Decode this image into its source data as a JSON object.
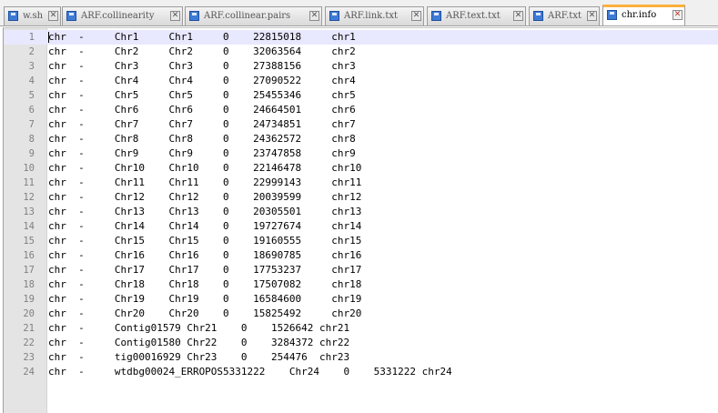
{
  "tabs": [
    {
      "label": "w.sh",
      "active": false
    },
    {
      "label": "ARF.collinearity",
      "active": false
    },
    {
      "label": "ARF.collinear.pairs",
      "active": false
    },
    {
      "label": "ARF.link.txt",
      "active": false
    },
    {
      "label": "ARF.text.txt",
      "active": false
    },
    {
      "label": "ARF.txt",
      "active": false
    },
    {
      "label": "chr.info",
      "active": true
    }
  ],
  "icons": {
    "tab_file": "save-disk-icon",
    "tab_close": "close-icon"
  },
  "colors": {
    "active_tab_accent": "#fbb13d",
    "current_line": "#e8e8ff",
    "gutter": "#e4e4e4",
    "line_number": "#808080"
  },
  "editor": {
    "lines": [
      {
        "n": "1",
        "text": "chr  -     Chr1     Chr1     0    22815018     chr1"
      },
      {
        "n": "2",
        "text": "chr  -     Chr2     Chr2     0    32063564     chr2"
      },
      {
        "n": "3",
        "text": "chr  -     Chr3     Chr3     0    27388156     chr3"
      },
      {
        "n": "4",
        "text": "chr  -     Chr4     Chr4     0    27090522     chr4"
      },
      {
        "n": "5",
        "text": "chr  -     Chr5     Chr5     0    25455346     chr5"
      },
      {
        "n": "6",
        "text": "chr  -     Chr6     Chr6     0    24664501     chr6"
      },
      {
        "n": "7",
        "text": "chr  -     Chr7     Chr7     0    24734851     chr7"
      },
      {
        "n": "8",
        "text": "chr  -     Chr8     Chr8     0    24362572     chr8"
      },
      {
        "n": "9",
        "text": "chr  -     Chr9     Chr9     0    23747858     chr9"
      },
      {
        "n": "10",
        "text": "chr  -     Chr10    Chr10    0    22146478     chr10"
      },
      {
        "n": "11",
        "text": "chr  -     Chr11    Chr11    0    22999143     chr11"
      },
      {
        "n": "12",
        "text": "chr  -     Chr12    Chr12    0    20039599     chr12"
      },
      {
        "n": "13",
        "text": "chr  -     Chr13    Chr13    0    20305501     chr13"
      },
      {
        "n": "14",
        "text": "chr  -     Chr14    Chr14    0    19727674     chr14"
      },
      {
        "n": "15",
        "text": "chr  -     Chr15    Chr15    0    19160555     chr15"
      },
      {
        "n": "16",
        "text": "chr  -     Chr16    Chr16    0    18690785     chr16"
      },
      {
        "n": "17",
        "text": "chr  -     Chr17    Chr17    0    17753237     chr17"
      },
      {
        "n": "18",
        "text": "chr  -     Chr18    Chr18    0    17507082     chr18"
      },
      {
        "n": "19",
        "text": "chr  -     Chr19    Chr19    0    16584600     chr19"
      },
      {
        "n": "20",
        "text": "chr  -     Chr20    Chr20    0    15825492     chr20"
      },
      {
        "n": "21",
        "text": "chr  -     Contig01579 Chr21    0    1526642 chr21"
      },
      {
        "n": "22",
        "text": "chr  -     Contig01580 Chr22    0    3284372 chr22"
      },
      {
        "n": "23",
        "text": "chr  -     tig00016929 Chr23    0    254476  chr23"
      },
      {
        "n": "24",
        "text": "chr  -     wtdbg00024_ERROPOS5331222    Chr24    0    5331222 chr24"
      }
    ]
  }
}
